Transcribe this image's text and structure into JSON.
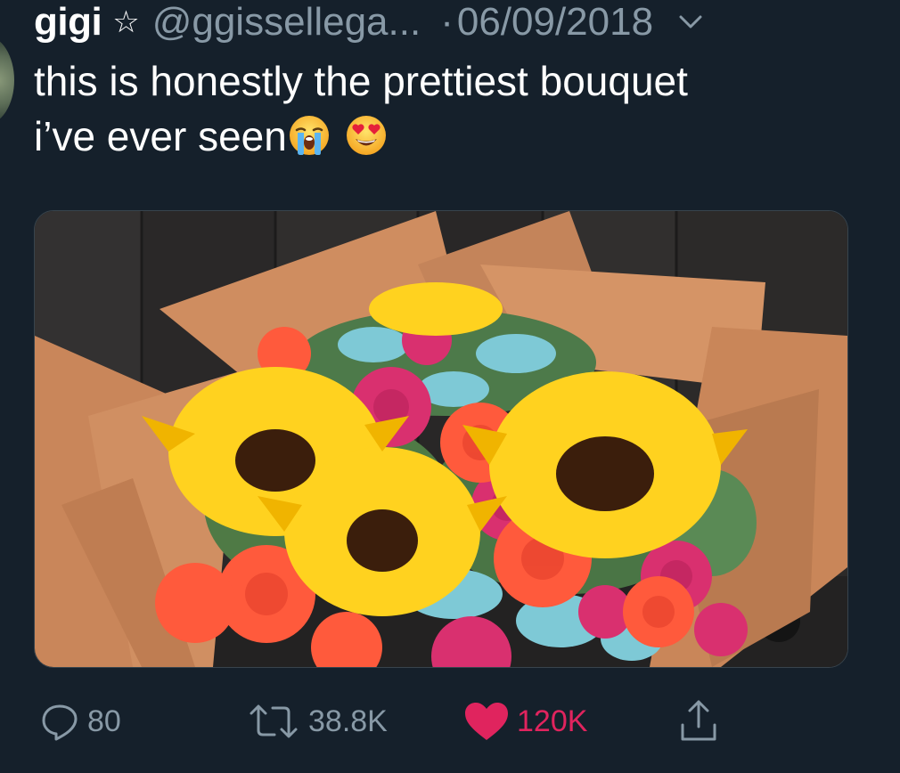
{
  "tweet": {
    "display_name": "gigi",
    "star_glyph": "☆",
    "handle": "@ggissellega...",
    "separator": "·",
    "date": "06/09/2018",
    "text_line1": "this is honestly the prettiest bouquet",
    "text_line2": "i’ve ever seen",
    "emojis": [
      "loudly-crying-face-emoji",
      "smiling-face-with-heart-eyes-emoji"
    ],
    "media_description_icon": "bouquet-photo"
  },
  "actions": {
    "reply_icon": "reply-icon",
    "reply_count": "80",
    "retweet_icon": "retweet-icon",
    "retweet_count": "38.8K",
    "like_icon": "heart-icon",
    "like_count": "120K",
    "share_icon": "share-icon"
  },
  "colors": {
    "background": "#15202b",
    "secondary_text": "#8899a6",
    "like_active": "#e0245e"
  }
}
